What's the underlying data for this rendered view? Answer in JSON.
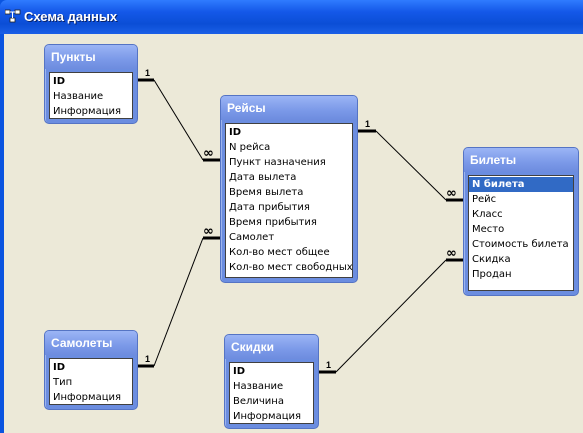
{
  "window": {
    "title": "Схема данных"
  },
  "tables": {
    "punkty": {
      "name": "Пункты",
      "fields": [
        "ID",
        "Название",
        "Информация"
      ]
    },
    "reisy": {
      "name": "Рейсы",
      "fields": [
        "ID",
        "N рейса",
        "Пункт назначения",
        "Дата вылета",
        "Время вылета",
        "Дата прибытия",
        "Время прибытия",
        "Самолет",
        "Кол-во мест общее",
        "Кол-во мест свободных"
      ]
    },
    "bilety": {
      "name": "Билеты",
      "fields": [
        "N билета",
        "Рейс",
        "Класс",
        "Место",
        "Стоимость билета",
        "Скидка",
        "Продан"
      ]
    },
    "samolety": {
      "name": "Самолеты",
      "fields": [
        "ID",
        "Тип",
        "Информация"
      ]
    },
    "skidki": {
      "name": "Скидки",
      "fields": [
        "ID",
        "Название",
        "Величина",
        "Информация"
      ]
    }
  },
  "relations": {
    "one_label": "1",
    "many_label": "∞"
  },
  "colors": {
    "title_bar": "#1458e8",
    "table_header": "#7b99e8",
    "selection": "#316ac5",
    "workspace": "#ece9d8"
  }
}
